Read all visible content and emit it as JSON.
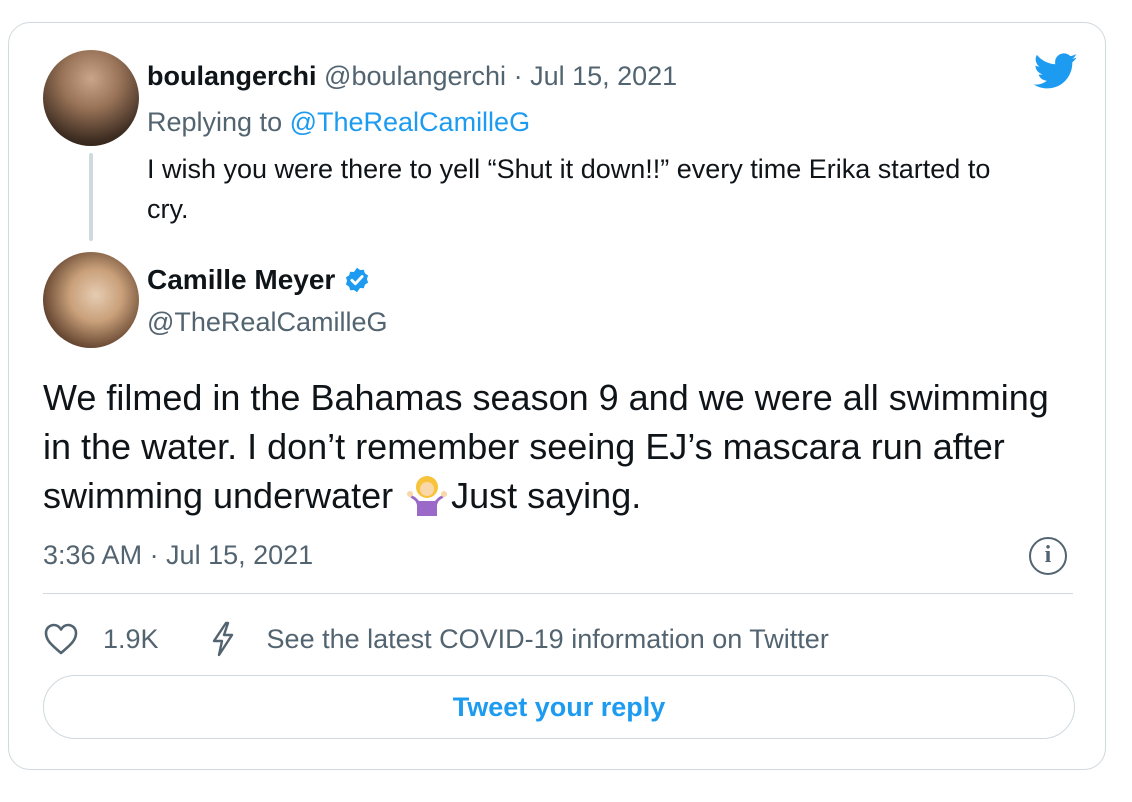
{
  "colors": {
    "accent": "#1d9bf0",
    "muted": "#536471",
    "text": "#0f1419",
    "border": "#cfd9de"
  },
  "icons": {
    "logo": "twitter-bird-icon",
    "verified": "verified-badge-icon",
    "emoji": "person-shrugging-emoji",
    "info": "info-icon",
    "like": "heart-icon",
    "covid": "lightning-bolt-icon"
  },
  "parent_tweet": {
    "display_name": "boulangerchi",
    "handle": "@boulangerchi",
    "separator": " · ",
    "date": "Jul 15, 2021",
    "replying_prefix": "Replying to ",
    "replying_to": "@TheRealCamilleG",
    "text": "I wish you were there to yell “Shut it down!!” every time Erika started to cry."
  },
  "main_tweet": {
    "display_name": "Camille Meyer",
    "handle": "@TheRealCamilleG",
    "text_part1": "We filmed in the Bahamas season 9 and we were all swimming in the water. I don’t remember seeing EJ’s mascara run after swimming  underwater ",
    "text_part2": "Just saying.",
    "timestamp": "3:36 AM · Jul 15, 2021"
  },
  "actions": {
    "like_count": "1.9K",
    "covid_link": "See the latest COVID-19 information on Twitter",
    "info_glyph": "i"
  },
  "reply_button": {
    "label": "Tweet your reply"
  }
}
